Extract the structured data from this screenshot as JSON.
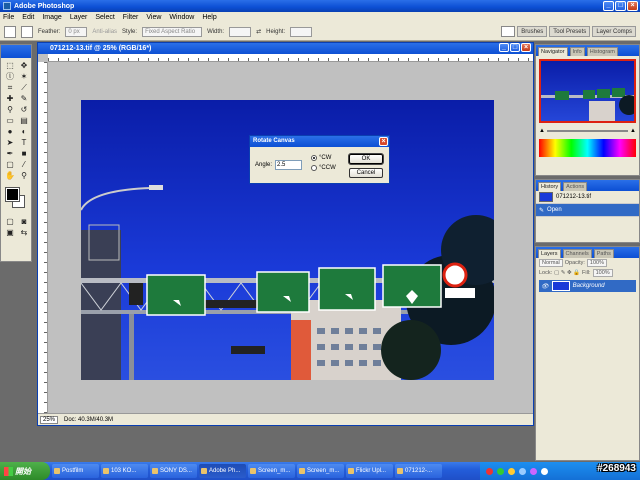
{
  "app": {
    "title": "Adobe Photoshop"
  },
  "menu": [
    "File",
    "Edit",
    "Image",
    "Layer",
    "Select",
    "Filter",
    "View",
    "Window",
    "Help"
  ],
  "options": {
    "feather_label": "Feather:",
    "feather_value": "0 px",
    "antialias_label": "Anti-alias",
    "style_label": "Style:",
    "style_value": "Fixed Aspect Ratio",
    "width_label": "Width:",
    "height_label": "Height:"
  },
  "wells": [
    "Brushes",
    "Tool Presets",
    "Layer Comps"
  ],
  "document": {
    "title": "071212-13.tif @ 25% (RGB/16*)",
    "zoom": "25%",
    "doc_size": "Doc: 40.3M/40.3M"
  },
  "dialog": {
    "title": "Rotate Canvas",
    "angle_label": "Angle:",
    "angle_value": "2.5",
    "cw_label": "°CW",
    "ccw_label": "°CCW",
    "cw_selected": true,
    "ok_label": "OK",
    "cancel_label": "Cancel"
  },
  "navigator": {
    "tabs": [
      "Navigator",
      "Info",
      "Histogram"
    ]
  },
  "history": {
    "tabs": [
      "History",
      "Actions"
    ],
    "items": [
      {
        "label": "071212-13.tif",
        "selected": false
      },
      {
        "label": "Open",
        "selected": true
      }
    ]
  },
  "layers": {
    "tabs": [
      "Layers",
      "Channels",
      "Paths"
    ],
    "blend": "Normal",
    "opacity_label": "Opacity:",
    "opacity_value": "100%",
    "lock_label": "Lock:",
    "fill_label": "Fill:",
    "fill_value": "100%",
    "items": [
      {
        "label": "Background"
      }
    ]
  },
  "taskbar": {
    "start_label": "開始",
    "tasks": [
      "Postfilm",
      "103 KO...",
      "SONY DS...",
      "Adobe Ph...",
      "Screen_m...",
      "Screen_m...",
      "Flickr Upl...",
      "071212-..."
    ],
    "active_index": 3
  },
  "watermark": "#268943",
  "colors": {
    "titlebar": "#0c4fd4",
    "taskbar": "#245edb",
    "start": "#2d8a29",
    "sky": "#1a3ad8",
    "sign": "#1e7a3c"
  }
}
